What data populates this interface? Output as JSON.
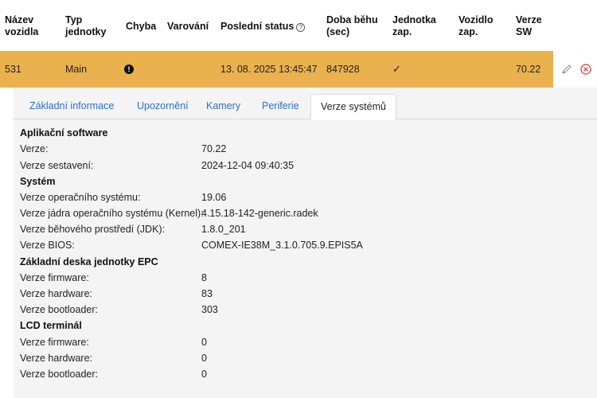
{
  "header": {
    "name": "Název vozidla",
    "unit_type": "Typ jednotky",
    "error": "Chyba",
    "warning": "Varování",
    "last_status": "Poslední status",
    "runtime": "Doba běhu (sec)",
    "unit_on": "Jednotka zap.",
    "vehicle_on": "Vozidlo zap.",
    "sw_version": "Verze SW"
  },
  "row": {
    "name": "531",
    "unit_type": "Main",
    "error_icon": "!",
    "last_status": "13. 08. 2025 13:45:47",
    "runtime": "847928",
    "unit_on": "✓",
    "sw_version": "70.22",
    "highlight_color": "#eab24e"
  },
  "tabs": [
    {
      "label": "Základní informace"
    },
    {
      "label": "Upozornění"
    },
    {
      "label": "Kamery"
    },
    {
      "label": "Periferie"
    },
    {
      "label": "Verze systémů"
    }
  ],
  "sections": {
    "app": {
      "title": "Aplikační software",
      "rows": [
        {
          "label": "Verze:",
          "value": "70.22"
        },
        {
          "label": "Verze sestavení:",
          "value": "2024-12-04 09:40:35"
        }
      ]
    },
    "system": {
      "title": "Systém",
      "rows": [
        {
          "label": "Verze operačního systému:",
          "value": "19.06"
        },
        {
          "label": "Verze jádra operačního systému (Kernel):",
          "value": "4.15.18-142-generic.radek"
        },
        {
          "label": "Verze běhového prostředí (JDK):",
          "value": "1.8.0_201"
        },
        {
          "label": "Verze BIOS:",
          "value": "COMEX-IE38M_3.1.0.705.9.EPIS5A"
        }
      ]
    },
    "epc": {
      "title": "Základní deska jednotky EPC",
      "rows": [
        {
          "label": "Verze firmware:",
          "value": "8"
        },
        {
          "label": "Verze hardware:",
          "value": "83"
        },
        {
          "label": "Verze bootloader:",
          "value": "303"
        }
      ]
    },
    "lcd": {
      "title": "LCD terminál",
      "rows": [
        {
          "label": "Verze firmware:",
          "value": "0"
        },
        {
          "label": "Verze hardware:",
          "value": "0"
        },
        {
          "label": "Verze bootloader:",
          "value": "0"
        }
      ]
    }
  }
}
